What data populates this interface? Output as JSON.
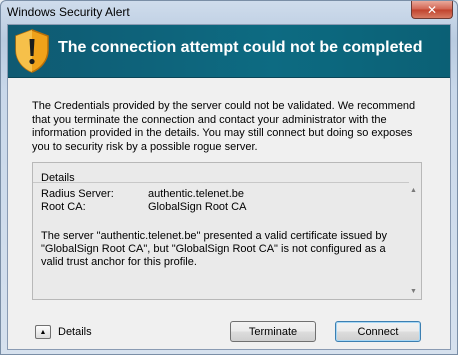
{
  "window": {
    "title": "Windows Security Alert",
    "close_glyph": "✕"
  },
  "banner": {
    "icon": "shield-warning-icon",
    "title": "The connection attempt could not be completed"
  },
  "message": "The Credentials provided by the server could not be validated. We recommend that you terminate the connection and contact your administrator with the information provided in the details. You may still connect but doing so exposes you to security risk by a possible rogue server.",
  "details": {
    "header": "Details",
    "rows": [
      {
        "key": "Radius Server:",
        "value": "authentic.telenet.be"
      },
      {
        "key": "Root CA:",
        "value": "GlobalSign Root CA"
      }
    ],
    "text": "The server \"authentic.telenet.be\" presented a valid certificate issued by \"GlobalSign Root CA\", but \"GlobalSign Root CA\" is not configured as a valid trust anchor for this profile."
  },
  "footer": {
    "toggle_glyph": "▲",
    "toggle_label": "Details",
    "terminate_label": "Terminate",
    "connect_label": "Connect"
  },
  "colors": {
    "banner": "#0d6b82",
    "shield": "#f0a21a"
  }
}
